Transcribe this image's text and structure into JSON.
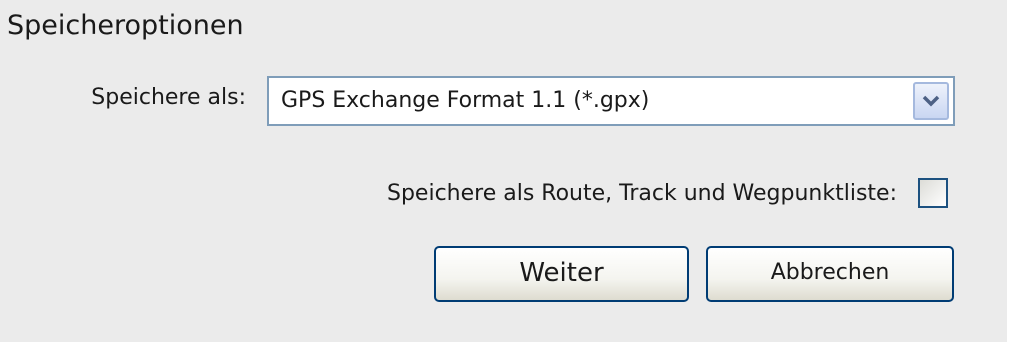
{
  "dialog": {
    "title": "Speicheroptionen"
  },
  "format": {
    "label": "Speichere als:",
    "selected": "GPS Exchange Format 1.1 (*.gpx)",
    "dropdown_icon": "chevron-down-icon"
  },
  "route_option": {
    "label": "Speichere als Route, Track und Wegpunktliste:",
    "checked": false
  },
  "buttons": {
    "continue_label": "Weiter",
    "cancel_label": "Abbrechen"
  },
  "colors": {
    "background": "#ebebeb",
    "input_border": "#7f9db9",
    "button_border": "#003c74",
    "checkbox_border": "#1c5180"
  }
}
